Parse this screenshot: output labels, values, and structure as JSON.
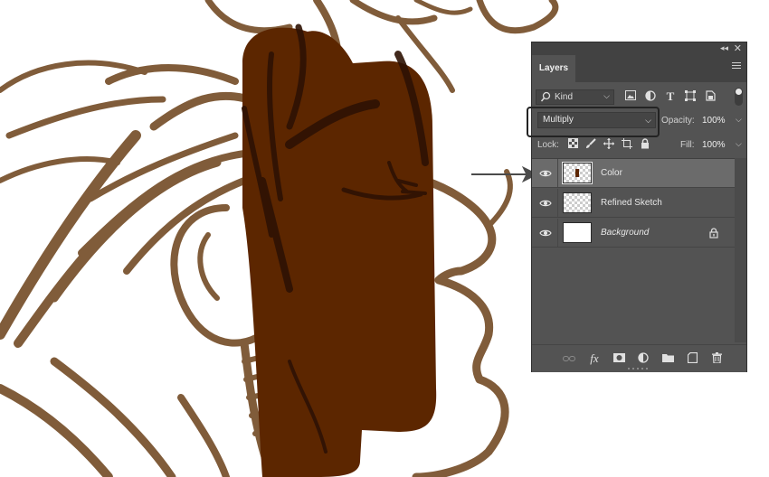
{
  "canvas": {
    "stroke_color": "#6b4018",
    "fill_color": "#5c2600"
  },
  "panel": {
    "title": "Layers",
    "collapse_icon": "double-chevron-icon",
    "close_icon": "close-icon",
    "menu_icon": "hamburger-menu-icon"
  },
  "filter": {
    "kind_label": "Kind",
    "icons": [
      "image-filter-icon",
      "adjustment-filter-icon",
      "type-filter-icon",
      "shape-filter-icon",
      "smart-object-filter-icon"
    ]
  },
  "blend": {
    "mode": "Multiply",
    "opacity_label": "Opacity:",
    "opacity_value": "100%"
  },
  "lock": {
    "label": "Lock:",
    "fill_label": "Fill:",
    "fill_value": "100%",
    "icons": [
      "lock-transparent-pixels-icon",
      "lock-image-pixels-icon",
      "lock-position-icon",
      "lock-artboard-icon",
      "lock-all-icon"
    ]
  },
  "layers": [
    {
      "name": "Color",
      "selected": true,
      "visible": true,
      "thumb": "checker-with-swatch"
    },
    {
      "name": "Refined Sketch",
      "selected": false,
      "visible": true,
      "thumb": "checker"
    },
    {
      "name": "Background",
      "selected": false,
      "visible": true,
      "thumb": "white",
      "locked": true,
      "italic": true
    }
  ],
  "footer_icons": [
    "link-layers-icon",
    "fx-icon",
    "add-mask-icon",
    "adjustment-layer-icon",
    "new-group-icon",
    "new-layer-icon",
    "delete-icon"
  ],
  "footer_fx": "fx",
  "colors": {
    "panel_bg": "#535353",
    "selected_row": "#6b6b6b",
    "brown_fill": "#5c2600"
  }
}
